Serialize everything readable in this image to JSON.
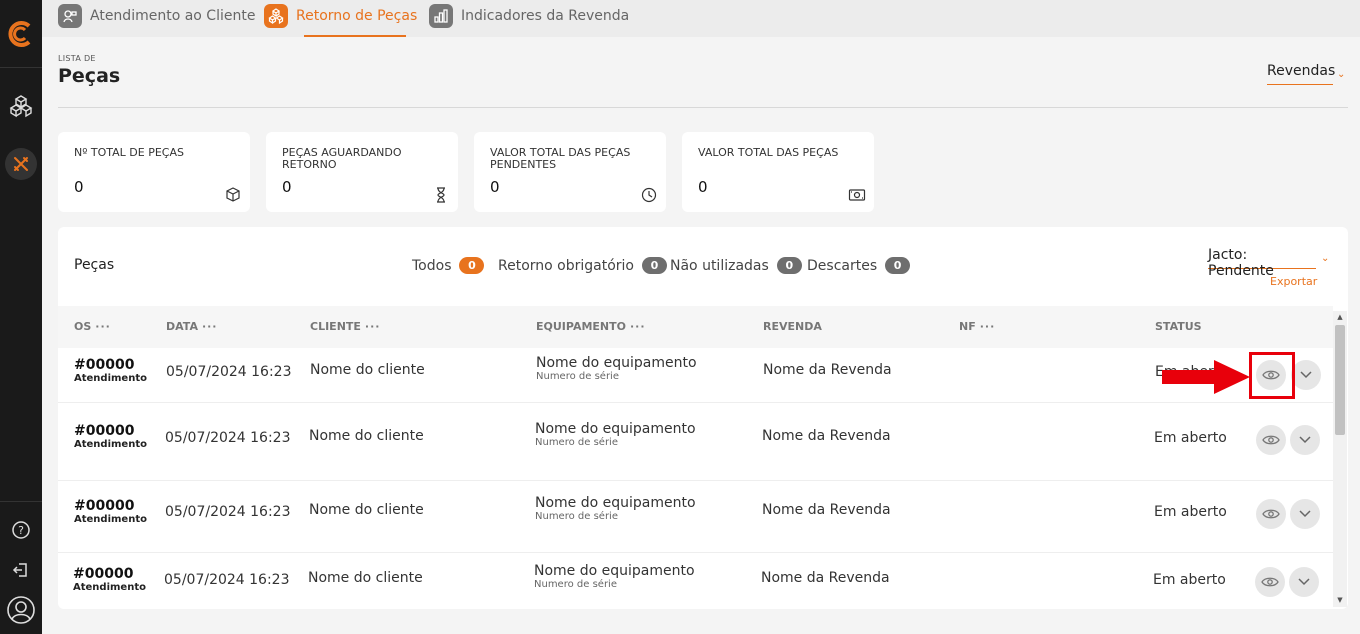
{
  "sidebar": {
    "logo_icon": "brand-logo-icon",
    "items": [
      {
        "icon": "cubes-icon"
      },
      {
        "icon": "tools-icon",
        "active": true
      }
    ],
    "bottom": [
      {
        "icon": "help-icon"
      },
      {
        "icon": "logout-icon"
      },
      {
        "icon": "user-avatar-icon"
      }
    ]
  },
  "tabs": [
    {
      "label": "Atendimento ao Cliente",
      "icon": "headset-icon",
      "active": false
    },
    {
      "label": "Retorno de Peças",
      "icon": "parts-return-icon",
      "active": true
    },
    {
      "label": "Indicadores da Revenda",
      "icon": "bar-chart-icon",
      "active": false
    }
  ],
  "header": {
    "eyebrow": "LISTA DE",
    "title": "Peças",
    "revendas_select": "Revendas"
  },
  "cards": [
    {
      "label": "Nº TOTAL DE PEÇAS",
      "value": "0",
      "icon": "box-icon"
    },
    {
      "label": "PEÇAS AGUARDANDO RETORNO",
      "value": "0",
      "icon": "hourglass-icon"
    },
    {
      "label": "VALOR TOTAL DAS PEÇAS PENDENTES",
      "value": "0",
      "icon": "clock-icon"
    },
    {
      "label": "VALOR TOTAL DAS PEÇAS",
      "value": "0",
      "icon": "money-icon"
    }
  ],
  "panel": {
    "title": "Peças",
    "filters": [
      {
        "label": "Todos",
        "count": "0",
        "active": true
      },
      {
        "label": "Retorno obrigatório",
        "count": "0"
      },
      {
        "label": "Não utilizadas",
        "count": "0"
      },
      {
        "label": "Descartes",
        "count": "0"
      }
    ],
    "status_select": "Jacto: Pendente",
    "export_label": "Exportar"
  },
  "table": {
    "columns": [
      {
        "label": "OS",
        "menu": "···"
      },
      {
        "label": "DATA",
        "menu": "···"
      },
      {
        "label": "CLIENTE",
        "menu": "···"
      },
      {
        "label": "EQUIPAMENTO",
        "menu": "···"
      },
      {
        "label": "REVENDA",
        "menu": ""
      },
      {
        "label": "NF",
        "menu": "···"
      },
      {
        "label": "STATUS",
        "menu": ""
      }
    ],
    "rows": [
      {
        "os": "#00000",
        "os_type": "Atendimento",
        "date": "05/07/2024 16:23",
        "client": "Nome do cliente",
        "equipment": "Nome do equipamento",
        "serial": "Numero de série",
        "revenda": "Nome da Revenda",
        "nf": "",
        "status": "Em aberto"
      },
      {
        "os": "#00000",
        "os_type": "Atendimento",
        "date": "05/07/2024 16:23",
        "client": "Nome do cliente",
        "equipment": "Nome do equipamento",
        "serial": "Numero de série",
        "revenda": "Nome da Revenda",
        "nf": "",
        "status": "Em aberto"
      },
      {
        "os": "#00000",
        "os_type": "Atendimento",
        "date": "05/07/2024 16:23",
        "client": "Nome do cliente",
        "equipment": "Nome do equipamento",
        "serial": "Numero de série",
        "revenda": "Nome da Revenda",
        "nf": "",
        "status": "Em aberto"
      },
      {
        "os": "#00000",
        "os_type": "Atendimento",
        "date": "05/07/2024 16:23",
        "client": "Nome do cliente",
        "equipment": "Nome do equipamento",
        "serial": "Numero de série",
        "revenda": "Nome da Revenda",
        "nf": "",
        "status": "Em aberto"
      }
    ],
    "row_actions": [
      "eye-icon",
      "chevron-down-icon"
    ]
  },
  "colors": {
    "accent": "#e8731e",
    "sidebar": "#1a1a1a",
    "annotation": "#e8000b"
  }
}
